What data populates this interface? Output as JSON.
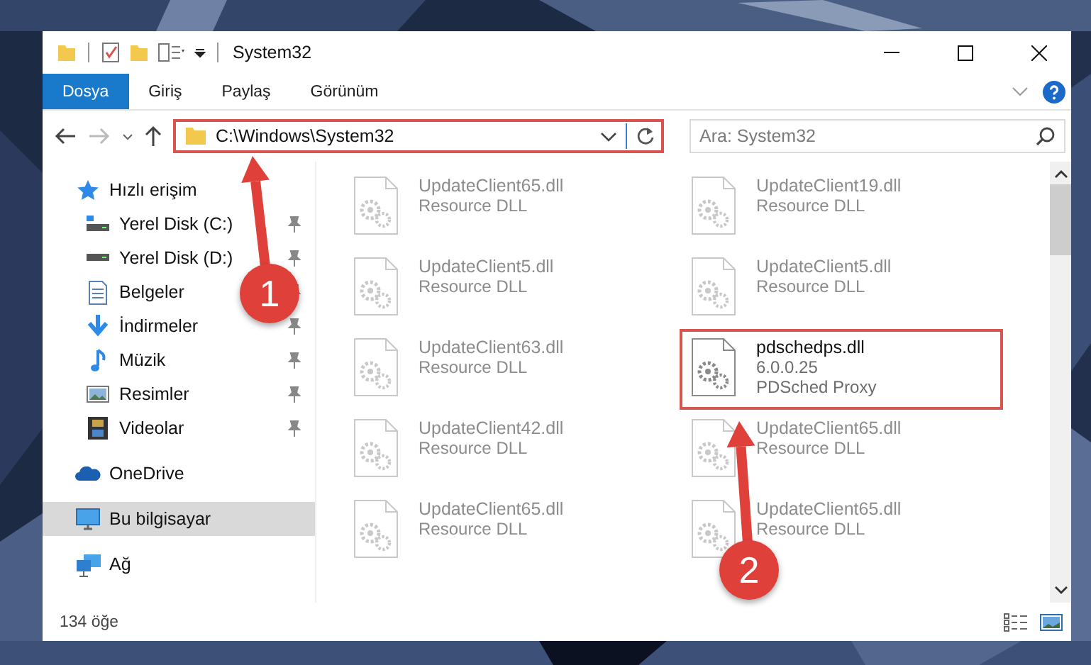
{
  "window": {
    "title": "System32"
  },
  "ribbon": {
    "tabs": [
      {
        "label": "Dosya",
        "kind": "file"
      },
      {
        "label": "Giriş",
        "kind": "tab"
      },
      {
        "label": "Paylaş",
        "kind": "tab"
      },
      {
        "label": "Görünüm",
        "kind": "tab"
      }
    ]
  },
  "address_bar": {
    "path": "C:\\Windows\\System32",
    "highlighted": true
  },
  "search": {
    "placeholder": "Ara: System32"
  },
  "sidebar": {
    "items": [
      {
        "label": "Hızlı erişim",
        "pinned": false,
        "selected": false
      },
      {
        "label": "Yerel Disk (C:)",
        "pinned": true,
        "selected": false
      },
      {
        "label": "Yerel Disk (D:)",
        "pinned": true,
        "selected": false
      },
      {
        "label": "Belgeler",
        "pinned": true,
        "selected": false
      },
      {
        "label": "İndirmeler",
        "pinned": true,
        "selected": false
      },
      {
        "label": "Müzik",
        "pinned": true,
        "selected": false
      },
      {
        "label": "Resimler",
        "pinned": true,
        "selected": false
      },
      {
        "label": "Videolar",
        "pinned": true,
        "selected": false
      },
      {
        "label": "OneDrive",
        "pinned": false,
        "selected": false
      },
      {
        "label": "Bu bilgisayar",
        "pinned": false,
        "selected": true
      },
      {
        "label": "Ağ",
        "pinned": false,
        "selected": false
      }
    ]
  },
  "files": [
    {
      "name": "UpdateClient65.dll",
      "details": [
        "Resource DLL"
      ],
      "faded": true,
      "highlighted": false
    },
    {
      "name": "UpdateClient19.dll",
      "details": [
        "Resource DLL"
      ],
      "faded": true,
      "highlighted": false
    },
    {
      "name": "UpdateClient5.dll",
      "details": [
        "Resource DLL"
      ],
      "faded": true,
      "highlighted": false
    },
    {
      "name": "UpdateClient5.dll",
      "details": [
        "Resource DLL"
      ],
      "faded": true,
      "highlighted": false
    },
    {
      "name": "UpdateClient63.dll",
      "details": [
        "Resource DLL"
      ],
      "faded": true,
      "highlighted": false
    },
    {
      "name": "pdschedps.dll",
      "details": [
        "6.0.0.25",
        "PDSched Proxy"
      ],
      "faded": false,
      "highlighted": true
    },
    {
      "name": "UpdateClient42.dll",
      "details": [
        "Resource DLL"
      ],
      "faded": true,
      "highlighted": false
    },
    {
      "name": "UpdateClient65.dll",
      "details": [
        "Resource DLL"
      ],
      "faded": true,
      "highlighted": false
    },
    {
      "name": "UpdateClient65.dll",
      "details": [
        "Resource DLL"
      ],
      "faded": true,
      "highlighted": false
    },
    {
      "name": "UpdateClient65.dll",
      "details": [
        "Resource DLL"
      ],
      "faded": true,
      "highlighted": false
    }
  ],
  "status_bar": {
    "item_count": "134 öğe"
  },
  "annotations": [
    {
      "label": "1"
    },
    {
      "label": "2"
    }
  ]
}
